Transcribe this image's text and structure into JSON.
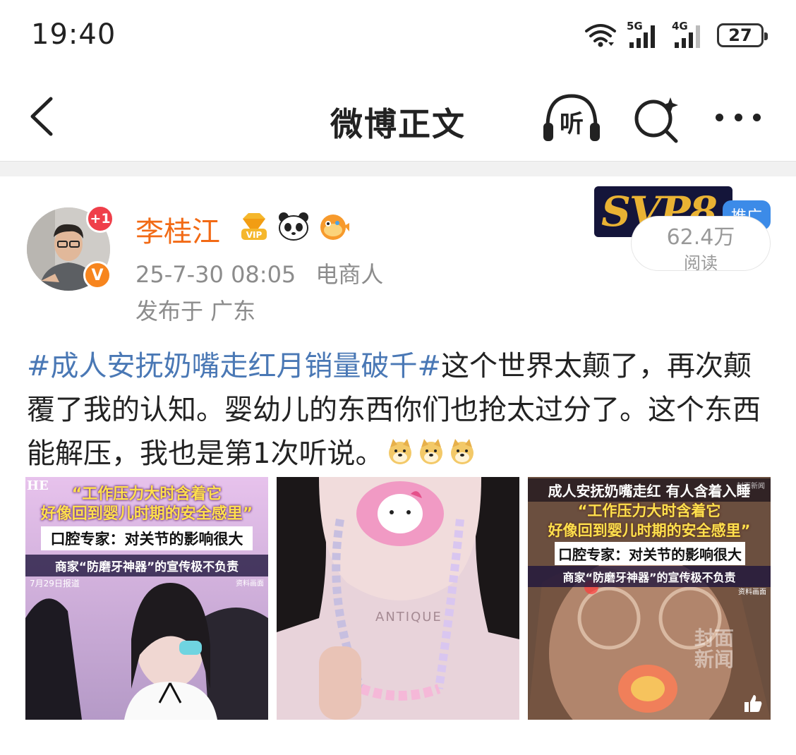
{
  "status_bar": {
    "time": "19:40",
    "signal1_type": "5G",
    "signal2_type": "4G",
    "battery": "27"
  },
  "nav": {
    "title": "微博正文",
    "listen_label": "听"
  },
  "author": {
    "name": "李桂江",
    "notification_count": "+1",
    "verified_label": "V",
    "date": "25-7-30 08:05",
    "source": "电商人",
    "location": "发布于 广东"
  },
  "ad": {
    "logo_text": "SVP8",
    "tag": "推广",
    "read_count": "62.4万",
    "read_label": "阅读"
  },
  "post": {
    "hashtag": "#成人安抚奶嘴走红月销量破千#",
    "text": "这个世界太颠了，再次颠覆了我的认知。婴幼儿的东西你们也抢太过分了。这个东西能解压，我也是第1次听说。"
  },
  "images": [
    {
      "header": "HE",
      "quote1": "“工作压力大时含着它",
      "quote2": "好像回到婴儿时期的安全感里”",
      "expert": "口腔专家：对关节的影响很大",
      "merchant": "商家“防磨牙神器”的宣传极不负责",
      "date_note": "7月29日报道",
      "source_note": "资料画面"
    },
    {
      "watermark": "ANTIQUE"
    },
    {
      "title": "成人安抚奶嘴走红 有人含着入睡",
      "quote1": "“工作压力大时含着它",
      "quote2": "好像回到婴儿时期的安全感里”",
      "expert": "口腔专家：对关节的影响很大",
      "merchant": "商家“防磨牙神器”的宣传极不负责",
      "source_note": "资料画面",
      "brand_watermark": "封面新闻",
      "top_watermark": "封面新闻"
    }
  ]
}
